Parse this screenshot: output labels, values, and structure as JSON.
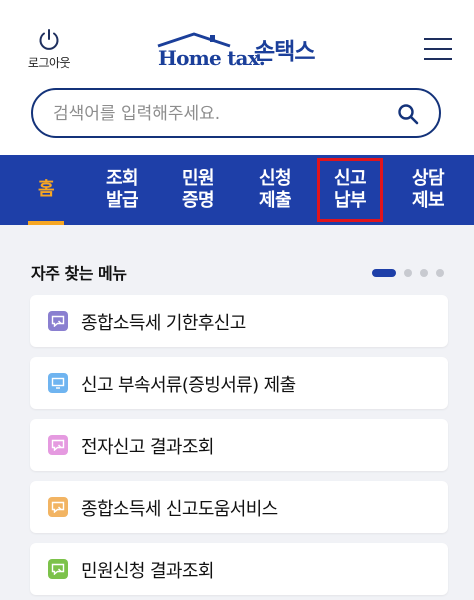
{
  "header": {
    "logout_label": "로그아웃",
    "logo_text": "Home tax.",
    "logo_sub": "손택스"
  },
  "search": {
    "placeholder": "검색어를 입력해주세요."
  },
  "nav": {
    "tabs": [
      {
        "label": "홈",
        "active": true,
        "highlighted": false
      },
      {
        "label": "조회\n발급",
        "active": false,
        "highlighted": false
      },
      {
        "label": "민원\n증명",
        "active": false,
        "highlighted": false
      },
      {
        "label": "신청\n제출",
        "active": false,
        "highlighted": false
      },
      {
        "label": "신고\n납부",
        "active": false,
        "highlighted": true
      },
      {
        "label": "상담\n제보",
        "active": false,
        "highlighted": false
      }
    ]
  },
  "favorites": {
    "title": "자주 찾는 메뉴",
    "pager": {
      "pages": 4,
      "current": 1
    },
    "items": [
      {
        "label": "종합소득세 기한후신고",
        "icon": "chat-icon",
        "color": "#8a7fd0"
      },
      {
        "label": "신고 부속서류(증빙서류) 제출",
        "icon": "monitor-icon",
        "color": "#6fb4f0"
      },
      {
        "label": "전자신고 결과조회",
        "icon": "chat-icon",
        "color": "#e59ae0"
      },
      {
        "label": "종합소득세 신고도움서비스",
        "icon": "chat-icon",
        "color": "#f2b463"
      },
      {
        "label": "민원신청 결과조회",
        "icon": "chat-icon",
        "color": "#7cc24a"
      }
    ]
  },
  "colors": {
    "nav_bg": "#1e3fa8",
    "accent": "#f6a623",
    "highlight_box": "#e0141c",
    "brand": "#1b3f9a"
  }
}
